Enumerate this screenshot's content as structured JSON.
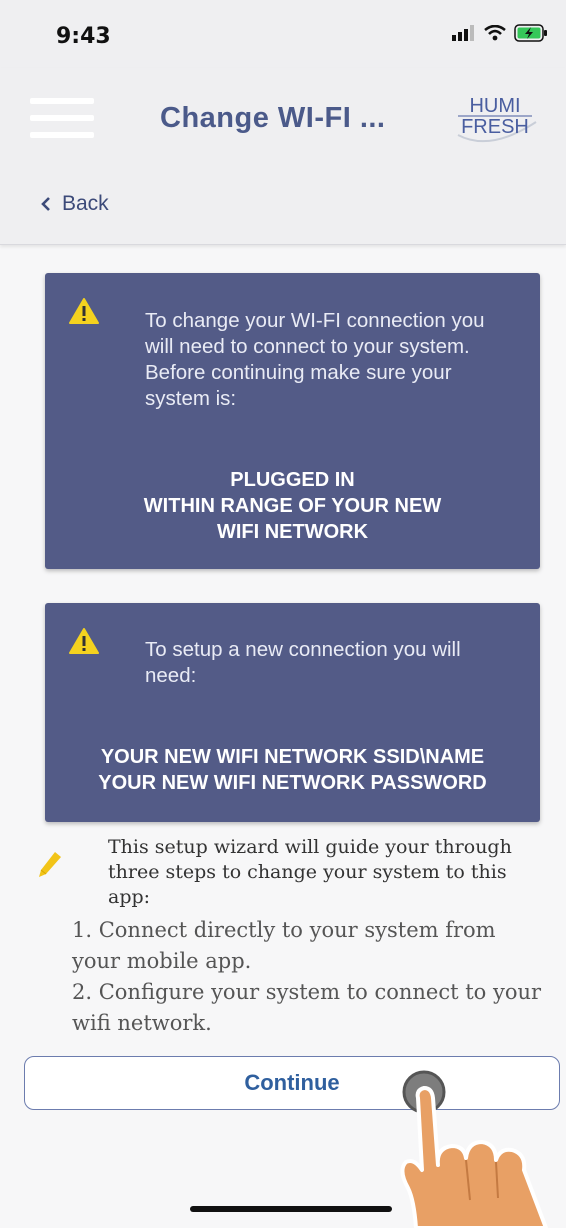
{
  "status_bar": {
    "time": "9:43"
  },
  "header": {
    "title": "Change WI-FI ...",
    "logo_line1": "HUMI",
    "logo_line2": "FRESH",
    "back_label": "Back"
  },
  "cards": [
    {
      "text": "To change your WI-FI connection you will need to connect to your system. Before continuing make sure your system is:",
      "caps_lines": [
        "PLUGGED IN",
        "WITHIN RANGE OF YOUR NEW",
        "WIFI NETWORK"
      ]
    },
    {
      "text": "To setup a new connection you will need:",
      "caps_lines": [
        "YOUR NEW WIFI NETWORK SSID\\NAME",
        "YOUR NEW WIFI NETWORK PASSWORD"
      ]
    }
  ],
  "intro": "This setup wizard will guide your through three steps to change your system to this app:",
  "steps": [
    "1. Connect directly to your system from your mobile app.",
    "2. Configure your system to connect to your wifi network."
  ],
  "continue_label": "Continue",
  "colors": {
    "card": "#535b87",
    "title": "#4b5a8a",
    "warning": "#f4d21f",
    "button_text": "#2f5f9e"
  },
  "icons": [
    "signal-icon",
    "wifi-icon",
    "battery-charging-icon",
    "menu-icon",
    "chevron-left-icon",
    "warning-icon",
    "pencil-icon"
  ]
}
